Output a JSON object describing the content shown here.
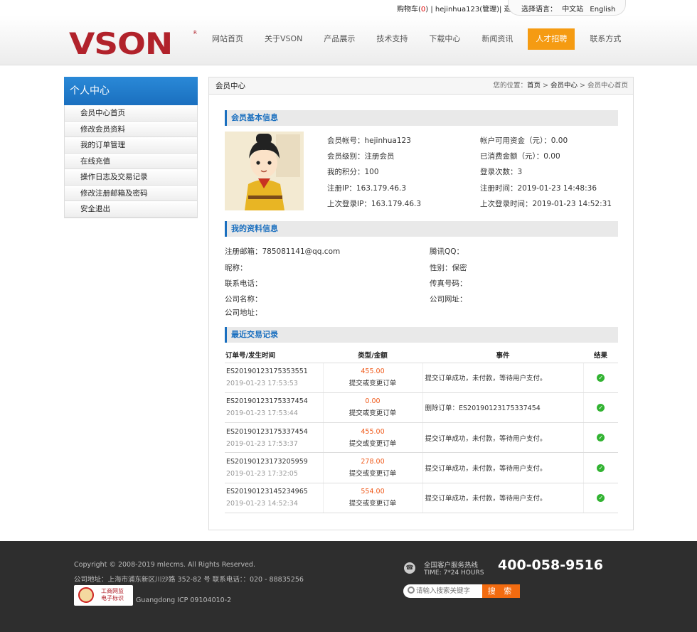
{
  "topbar": {
    "cart_label": "购物车(",
    "cart_count": "0",
    "cart_close": ")",
    "user": " | hejinhua123(管理)|",
    "logout": " 退出"
  },
  "lang": {
    "label": "选择语言：",
    "zh": "中文站",
    "en": "English"
  },
  "brand": {
    "logo": "VSON",
    "reg": "R",
    "color": "#b1222b"
  },
  "nav": [
    {
      "label": "网站首页"
    },
    {
      "label": "关于VSON"
    },
    {
      "label": "产品展示"
    },
    {
      "label": "技术支持"
    },
    {
      "label": "下载中心"
    },
    {
      "label": "新闻资讯"
    },
    {
      "label": "人才招聘",
      "active": true
    },
    {
      "label": "联系方式"
    }
  ],
  "sidebar": {
    "title": "个人中心",
    "items": [
      "会员中心首页",
      "修改会员资料",
      "我的订单管理",
      "在线充值",
      "操作日志及交易记录",
      "修改注册邮箱及密码",
      "安全退出"
    ]
  },
  "main": {
    "bar_title": "会员中心",
    "crumb": {
      "label": "您的位置：",
      "home": "首页",
      "sep1": " > ",
      "center": "会员中心",
      "sep2": " > ",
      "current": "会员中心首页"
    }
  },
  "basic": {
    "title": "会员基本信息",
    "left": [
      "会员帐号：hejinhua123",
      "会员级别：注册会员",
      "我的积分：100",
      "注册IP：163.179.46.3",
      "上次登录IP：163.179.46.3"
    ],
    "right": [
      "帐户可用资金（元）：0.00",
      "已消费金额（元）：0.00",
      "登录次数：3",
      "注册时间：2019-01-23 14:48:36",
      "上次登录时间：2019-01-23 14:52:31"
    ]
  },
  "profile": {
    "title": "我的资料信息",
    "left": [
      "注册邮箱：785081141@qq.com",
      "昵称：",
      "联系电话：",
      "公司名称：",
      "公司地址："
    ],
    "right": [
      "腾讯QQ：",
      "性别：保密",
      "传真号码：",
      "公司网址："
    ]
  },
  "transactions": {
    "title": "最近交易记录",
    "headers": [
      "订单号/发生时间",
      "类型/金额",
      "事件",
      "结果"
    ],
    "rows": [
      {
        "order": "ES20190123175353551",
        "time": "2019-01-23 17:53:53",
        "amount": "455.00",
        "type": "提交或变更订单",
        "event": "提交订单成功，未付款，等待用户支付。"
      },
      {
        "order": "ES20190123175337454",
        "time": "2019-01-23 17:53:44",
        "amount": "0.00",
        "type": "提交或变更订单",
        "event": "删除订单：ES20190123175337454"
      },
      {
        "order": "ES20190123175337454",
        "time": "2019-01-23 17:53:37",
        "amount": "455.00",
        "type": "提交或变更订单",
        "event": "提交订单成功，未付款，等待用户支付。"
      },
      {
        "order": "ES20190123173205959",
        "time": "2019-01-23 17:32:05",
        "amount": "278.00",
        "type": "提交或变更订单",
        "event": "提交订单成功，未付款，等待用户支付。"
      },
      {
        "order": "ES20190123145234965",
        "time": "2019-01-23 14:52:34",
        "amount": "554.00",
        "type": "提交或变更订单",
        "event": "提交订单成功，未付款，等待用户支付。"
      }
    ]
  },
  "footer": {
    "copyright": "Copyright © 2008-2019 mlecms. All Rights Reserved.",
    "address": "公司地址：上海市浦东新区川沙路 352-82 号 联系电话：：020 - 88835256",
    "badge_line1": "工商网监",
    "badge_line2": "电子标识",
    "icp": "Guangdong ICP 09104010-2",
    "hotline_label": "全国客户服务热线",
    "hotline_time": "TIME: 7*24 HOURS",
    "phone": "400-058-9516",
    "search_placeholder": "请输入搜索关键字",
    "search_button": "搜 索"
  }
}
